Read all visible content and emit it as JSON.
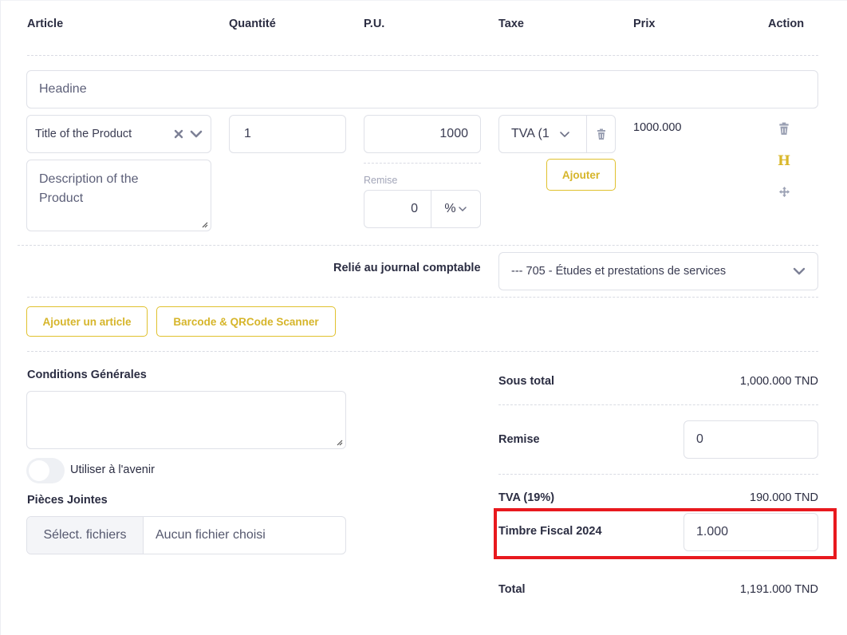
{
  "columns": {
    "article": "Article",
    "quantite": "Quantité",
    "pu": "P.U.",
    "taxe": "Taxe",
    "prix": "Prix",
    "action": "Action"
  },
  "headline": {
    "value": "Headine"
  },
  "item": {
    "product_select": "Title of the Product",
    "description": "Description of the\nProduct",
    "quantity": "1",
    "unit_price": "1000",
    "remise_label": "Remise",
    "remise_value": "0",
    "remise_unit": "%",
    "tax_select": "TVA (1",
    "ajouter_label": "Ajouter",
    "price": "1000.000",
    "heading_icon_glyph": "H"
  },
  "journal": {
    "label": "Relié au journal comptable",
    "selected": "--- 705 - Études et prestations de services"
  },
  "buttons": {
    "add_article": "Ajouter un article",
    "scanner": "Barcode & QRCode Scanner"
  },
  "conditions": {
    "label": "Conditions Générales",
    "value": "",
    "toggle_label": "Utiliser à l'avenir",
    "toggle_on": false
  },
  "attachments": {
    "label": "Pièces Jointes",
    "choose_button": "Sélect. fichiers",
    "no_file": "Aucun fichier choisi"
  },
  "summary": {
    "subtotal_label": "Sous total",
    "subtotal_value": "1,000.000 TND",
    "remise_label": "Remise",
    "remise_value": "0",
    "tva_label": "TVA (19%)",
    "tva_value": "190.000 TND",
    "timbre_label": "Timbre Fiscal 2024",
    "timbre_value": "1.000",
    "total_label": "Total",
    "total_value": "1,191.000 TND"
  },
  "colors": {
    "accent": "#e0c12e",
    "highlight": "#e8191e",
    "text": "#2b2d42",
    "border": "#dfe1e8"
  }
}
